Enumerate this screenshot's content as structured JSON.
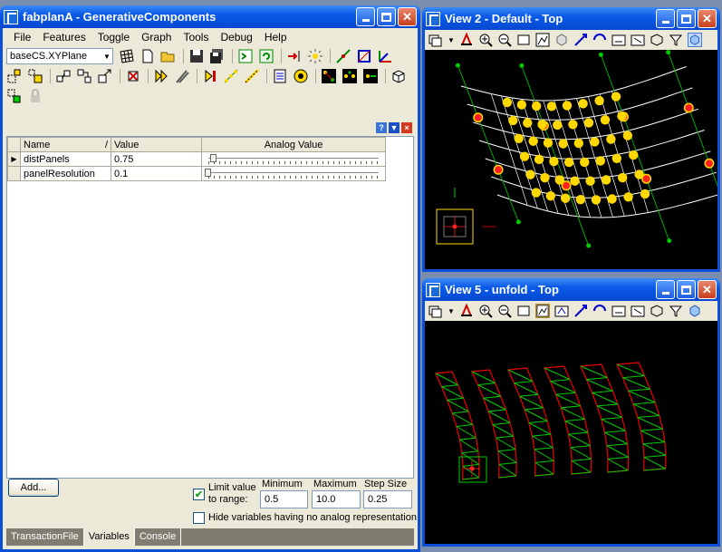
{
  "main_window": {
    "title": "fabplanA - GenerativeComponents",
    "menu": [
      "File",
      "Features",
      "Toggle",
      "Graph",
      "Tools",
      "Debug",
      "Help"
    ],
    "coordinate_system": "baseCS.XYPlane",
    "panel_buttons": {
      "help": "?",
      "collapse": "▼",
      "close": "×"
    },
    "table": {
      "columns": [
        "Name",
        "/",
        "Value",
        "Analog Value"
      ],
      "rows": [
        {
          "name": "distPanels",
          "value": "0.75",
          "slider_fraction": 0.03
        },
        {
          "name": "panelResolution",
          "value": "0.1",
          "slider_fraction": 0.0
        }
      ]
    },
    "add_button": "Add...",
    "limit_value_label_1": "Limit value",
    "limit_value_label_2": "to range:",
    "limit_checked": true,
    "minimum_label": "Minimum",
    "maximum_label": "Maximum",
    "step_label": "Step Size",
    "minimum_value": "0.5",
    "maximum_value": "10.0",
    "step_value": "0.25",
    "hide_label": "Hide variables having no analog representation",
    "hide_checked": false,
    "tabs": [
      "TransactionFile",
      "Variables",
      "Console"
    ],
    "active_tab": "Variables"
  },
  "view2": {
    "title": "View 2 - Default - Top"
  },
  "view5": {
    "title": "View 5 - unfold - Top"
  },
  "colors": {
    "xp_blue": "#0a4fd6",
    "dialog_bg": "#ece9d8",
    "canvas_bg": "#000000"
  }
}
